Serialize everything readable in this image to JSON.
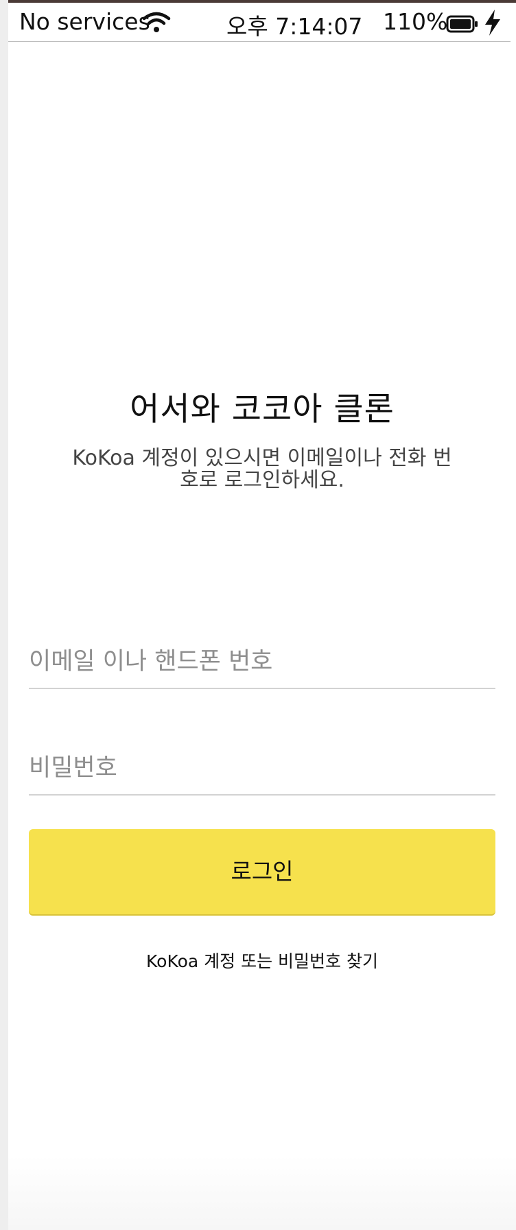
{
  "status_bar": {
    "carrier": "No services",
    "time": "오후 7:14:07",
    "battery": "110%",
    "icons": [
      "wifi-icon",
      "battery-icon",
      "charging-bolt-icon"
    ]
  },
  "welcome": {
    "title": "어서와 코코아 클론",
    "subtitle": "KoKoa 계정이 있으시면 이메일이나 전화 번호로 로그인하세요."
  },
  "form": {
    "email_placeholder": "이메일 이나 핸드폰 번호",
    "email_value": "",
    "password_placeholder": "비밀번호",
    "password_value": "",
    "login_label": "로그인"
  },
  "links": {
    "find_account": "KoKoa 계정 또는 비밀번호 찾기"
  },
  "colors": {
    "accent": "#f6e14d",
    "text": "#111111",
    "placeholder": "#8e8e8e",
    "divider": "#d2d2d2"
  }
}
